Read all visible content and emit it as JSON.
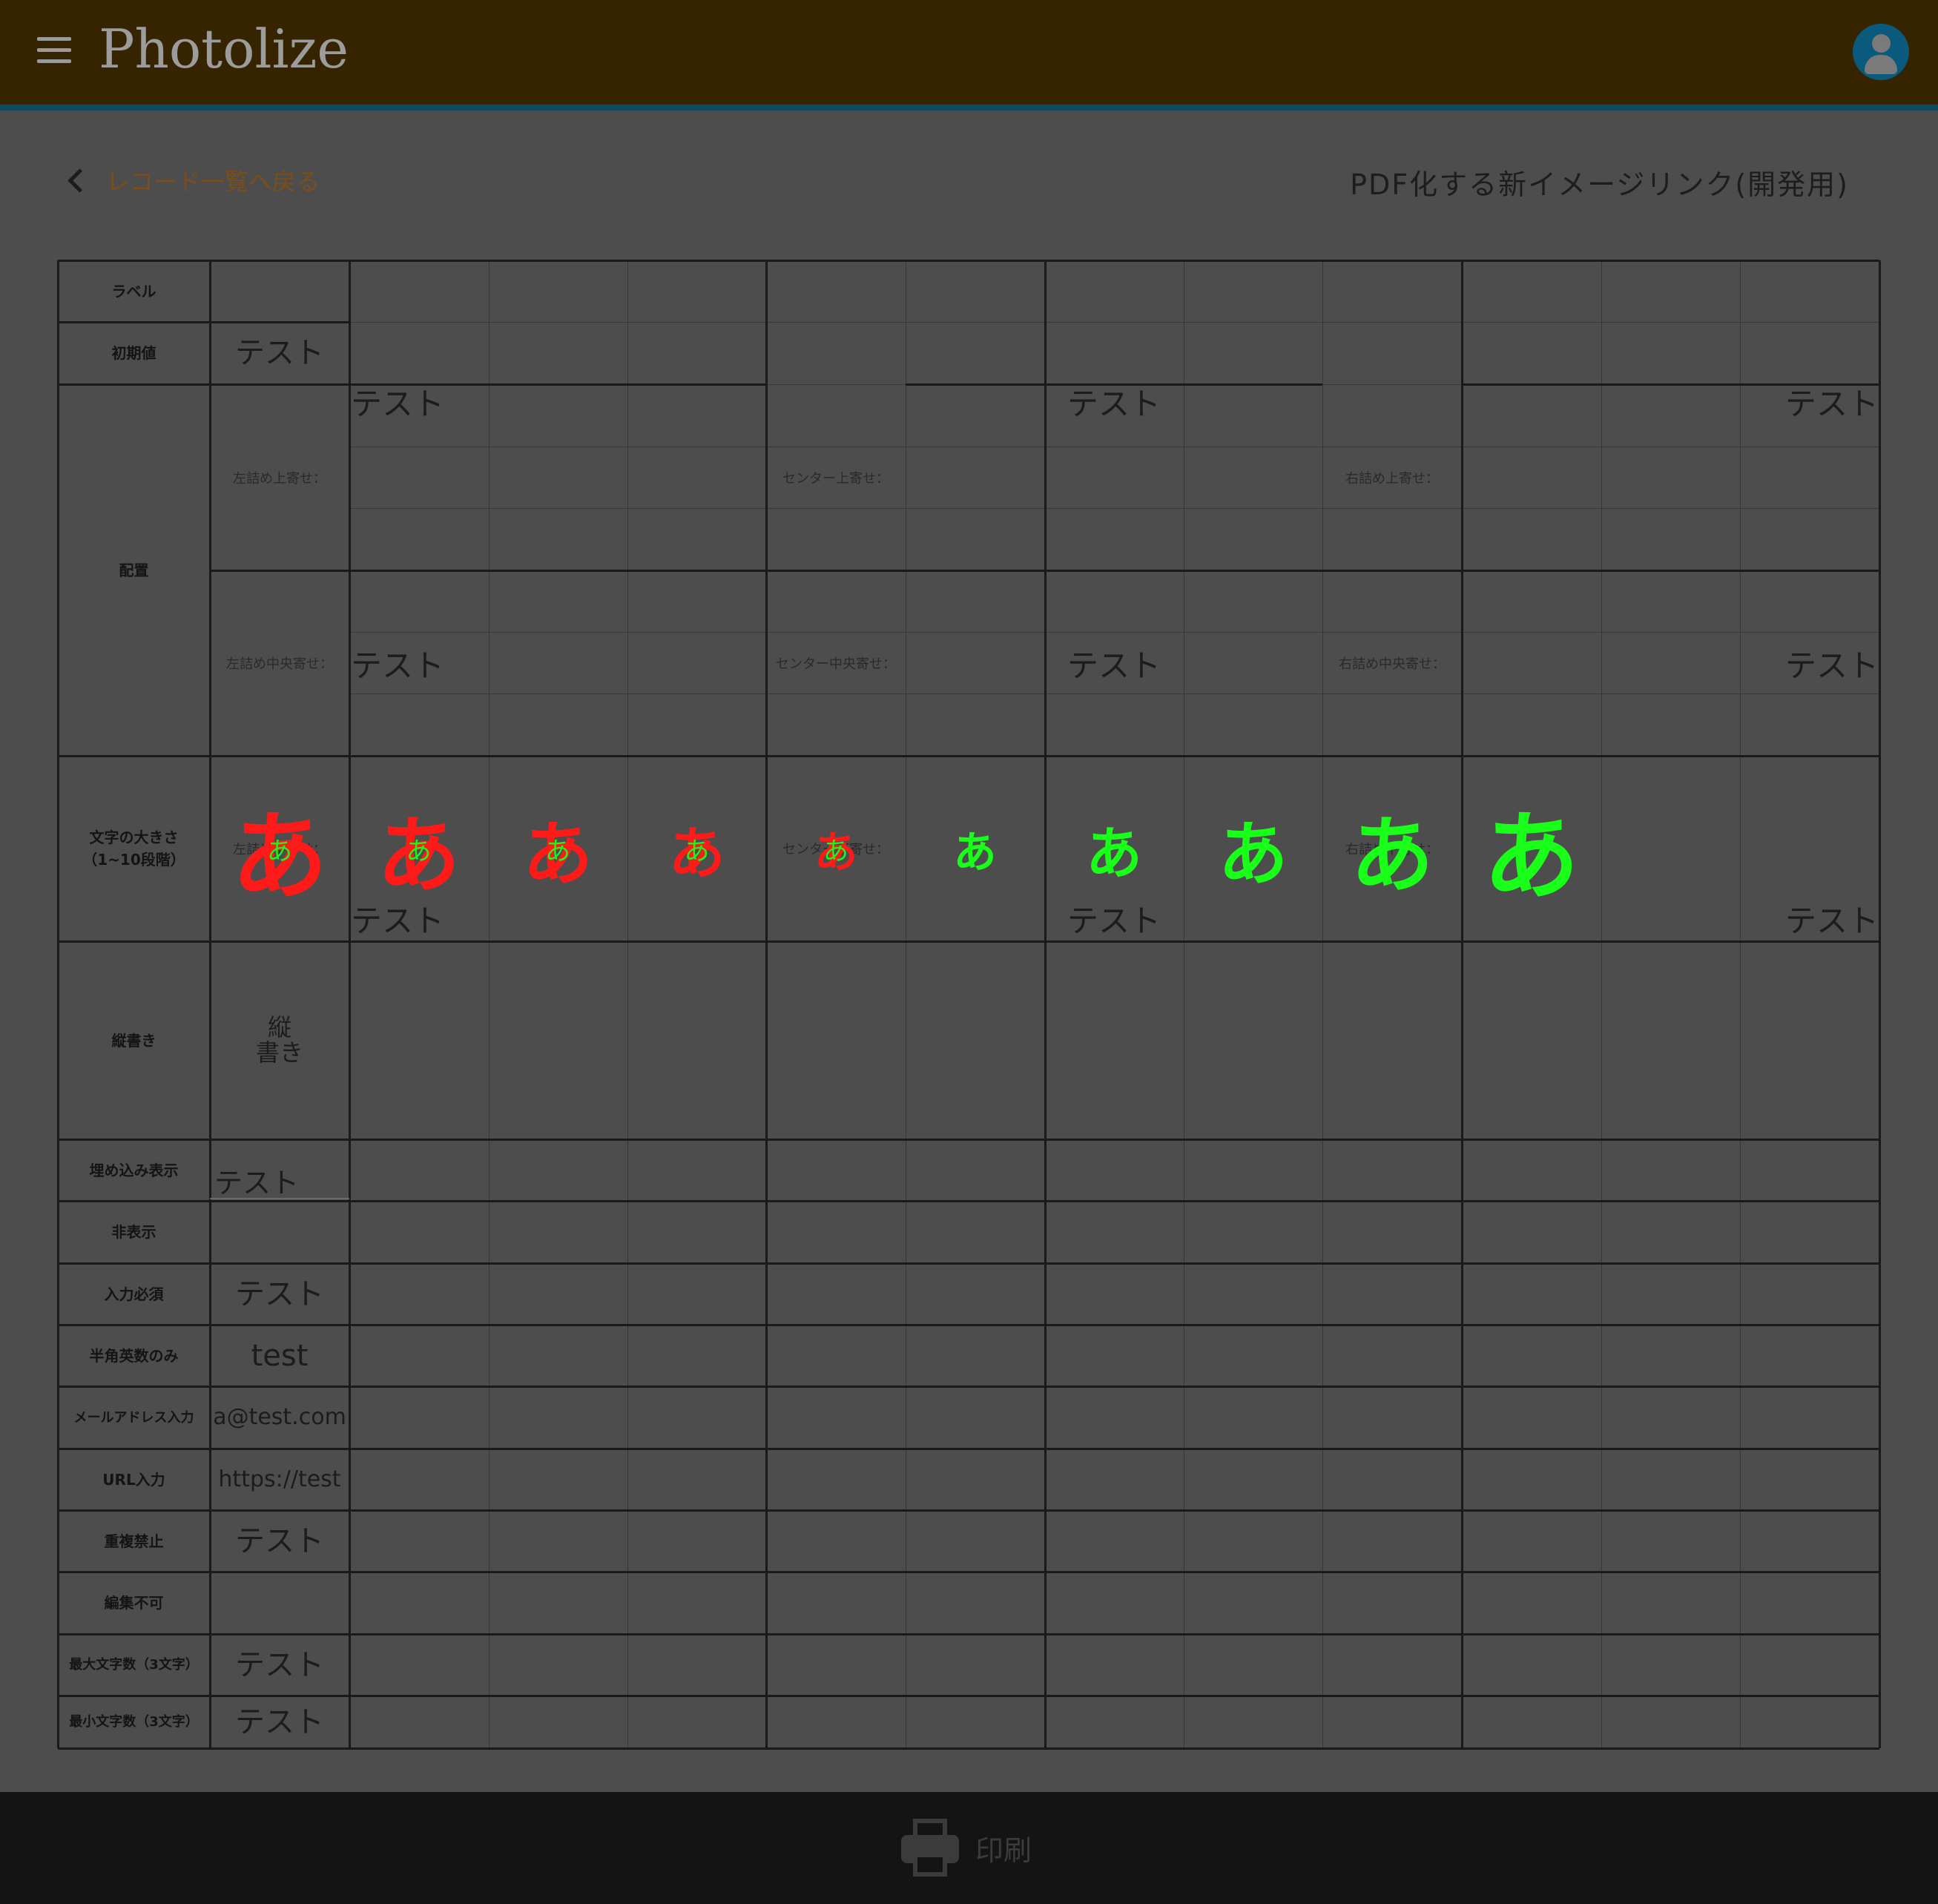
{
  "header": {
    "app_title": "Photolize",
    "menu_icon": "hamburger-menu-icon",
    "avatar_icon": "user-account-icon",
    "colors": {
      "bar": "#362300",
      "accent_line": "#0f4a63"
    }
  },
  "nav": {
    "back_label": "レコード一覧へ戻る",
    "page_title": "PDF化する新イメージリンク(開発用)"
  },
  "form": {
    "row_labels": {
      "label": "ラベル",
      "initial": "初期値",
      "layout": "配置",
      "size": "文字の大きさ\n（1~10段階）",
      "vertical": "縦書き",
      "embed": "埋め込み表示",
      "hidden": "非表示",
      "required": "入力必須",
      "halfwidth": "半角英数のみ",
      "email": "メールアドレス入力",
      "url": "URL入力",
      "nodup": "重複禁止",
      "readonly": "編集不可",
      "maxlen": "最大文字数（3文字）",
      "minlen": "最小文字数（3文字）"
    },
    "layout_labels": {
      "left_top": "左詰め上寄せ：",
      "left_mid": "左詰め中央寄せ：",
      "left_bot": "左詰め下寄せ：",
      "center_top": "センター上寄せ：",
      "center_mid": "センター中央寄せ：",
      "center_bot": "センター下寄せ：",
      "right_top": "右詰め上寄せ：",
      "right_mid": "右詰め中央寄せ：",
      "right_bot": "右詰め下寄せ："
    },
    "values": {
      "initial": "テスト",
      "sample": "テスト",
      "vertical": "縦\n書き",
      "embed": "テスト",
      "required": "テスト",
      "halfwidth": "test",
      "email": "a@test.com",
      "url": "https://test",
      "nodup": "テスト",
      "maxlen": "テスト",
      "minlen": "テスト"
    },
    "size_glyph": "あ",
    "size_levels": [
      10,
      8,
      6,
      4,
      2,
      2,
      4,
      6,
      8,
      10
    ],
    "size_colors": {
      "red": "#ff1a1a",
      "green": "#1aff1a"
    }
  },
  "footer": {
    "print_label": "印刷",
    "print_icon": "printer-icon"
  }
}
